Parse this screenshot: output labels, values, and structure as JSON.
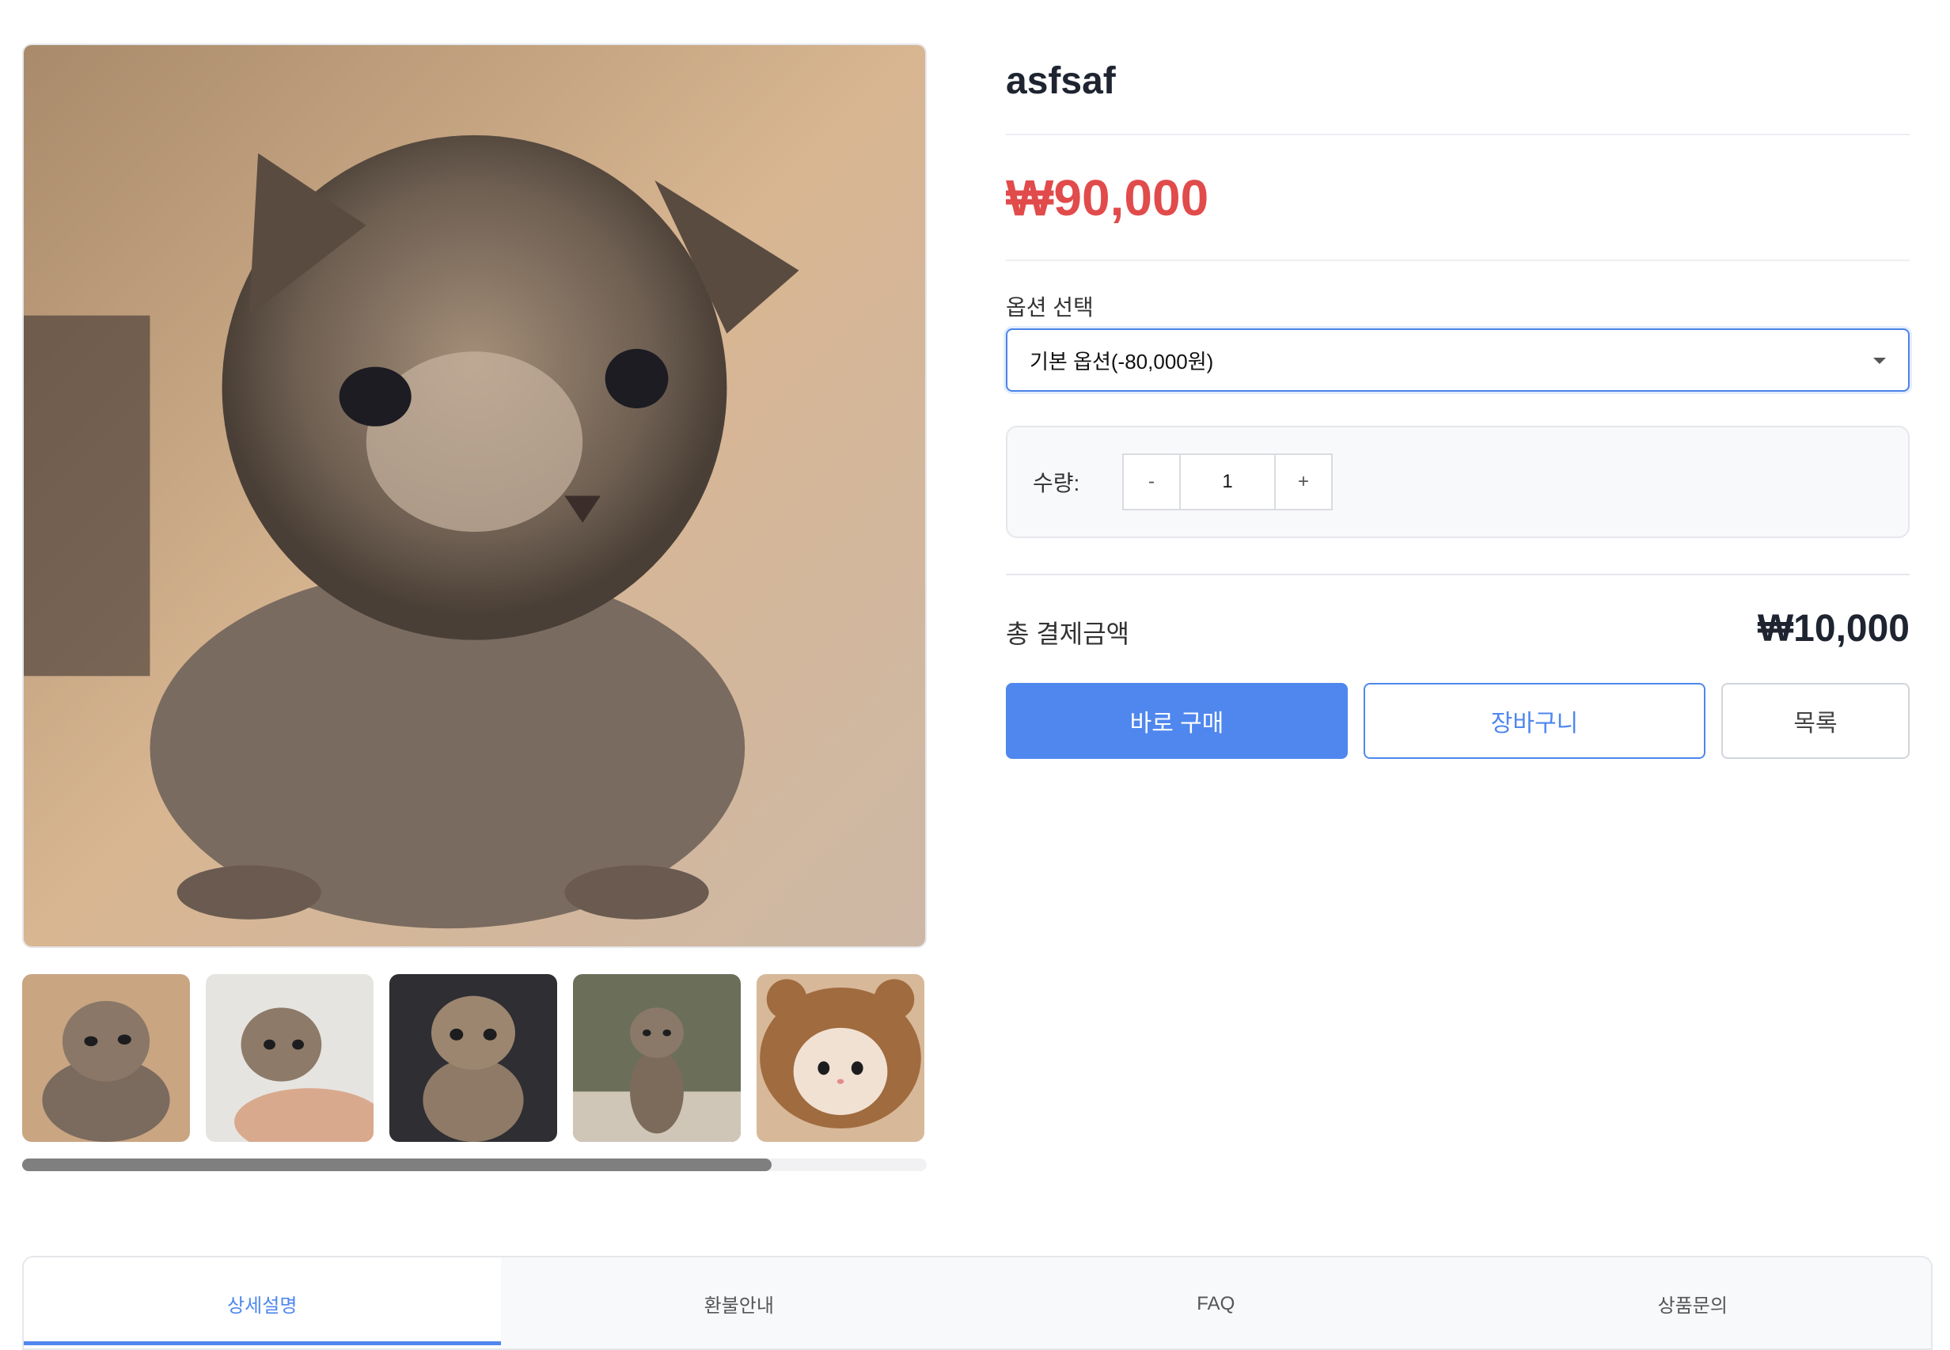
{
  "product": {
    "title": "asfsaf",
    "price": "₩90,000"
  },
  "option": {
    "label": "옵션 선택",
    "selected": "기본 옵션(-80,000원)"
  },
  "quantity": {
    "label": "수량:",
    "minus": "-",
    "value": "1",
    "plus": "+"
  },
  "total": {
    "label": "총 결제금액",
    "value": "₩10,000"
  },
  "actions": {
    "buy": "바로 구매",
    "cart": "장바구니",
    "list": "목록"
  },
  "gallery": {
    "thumbnail_count": 5,
    "scroll_position": 0.83
  },
  "tabs": [
    "상세설명",
    "환불안내",
    "FAQ",
    "상품문의"
  ],
  "colors": {
    "price": "#e14b4b",
    "accent": "#4f87ee"
  }
}
